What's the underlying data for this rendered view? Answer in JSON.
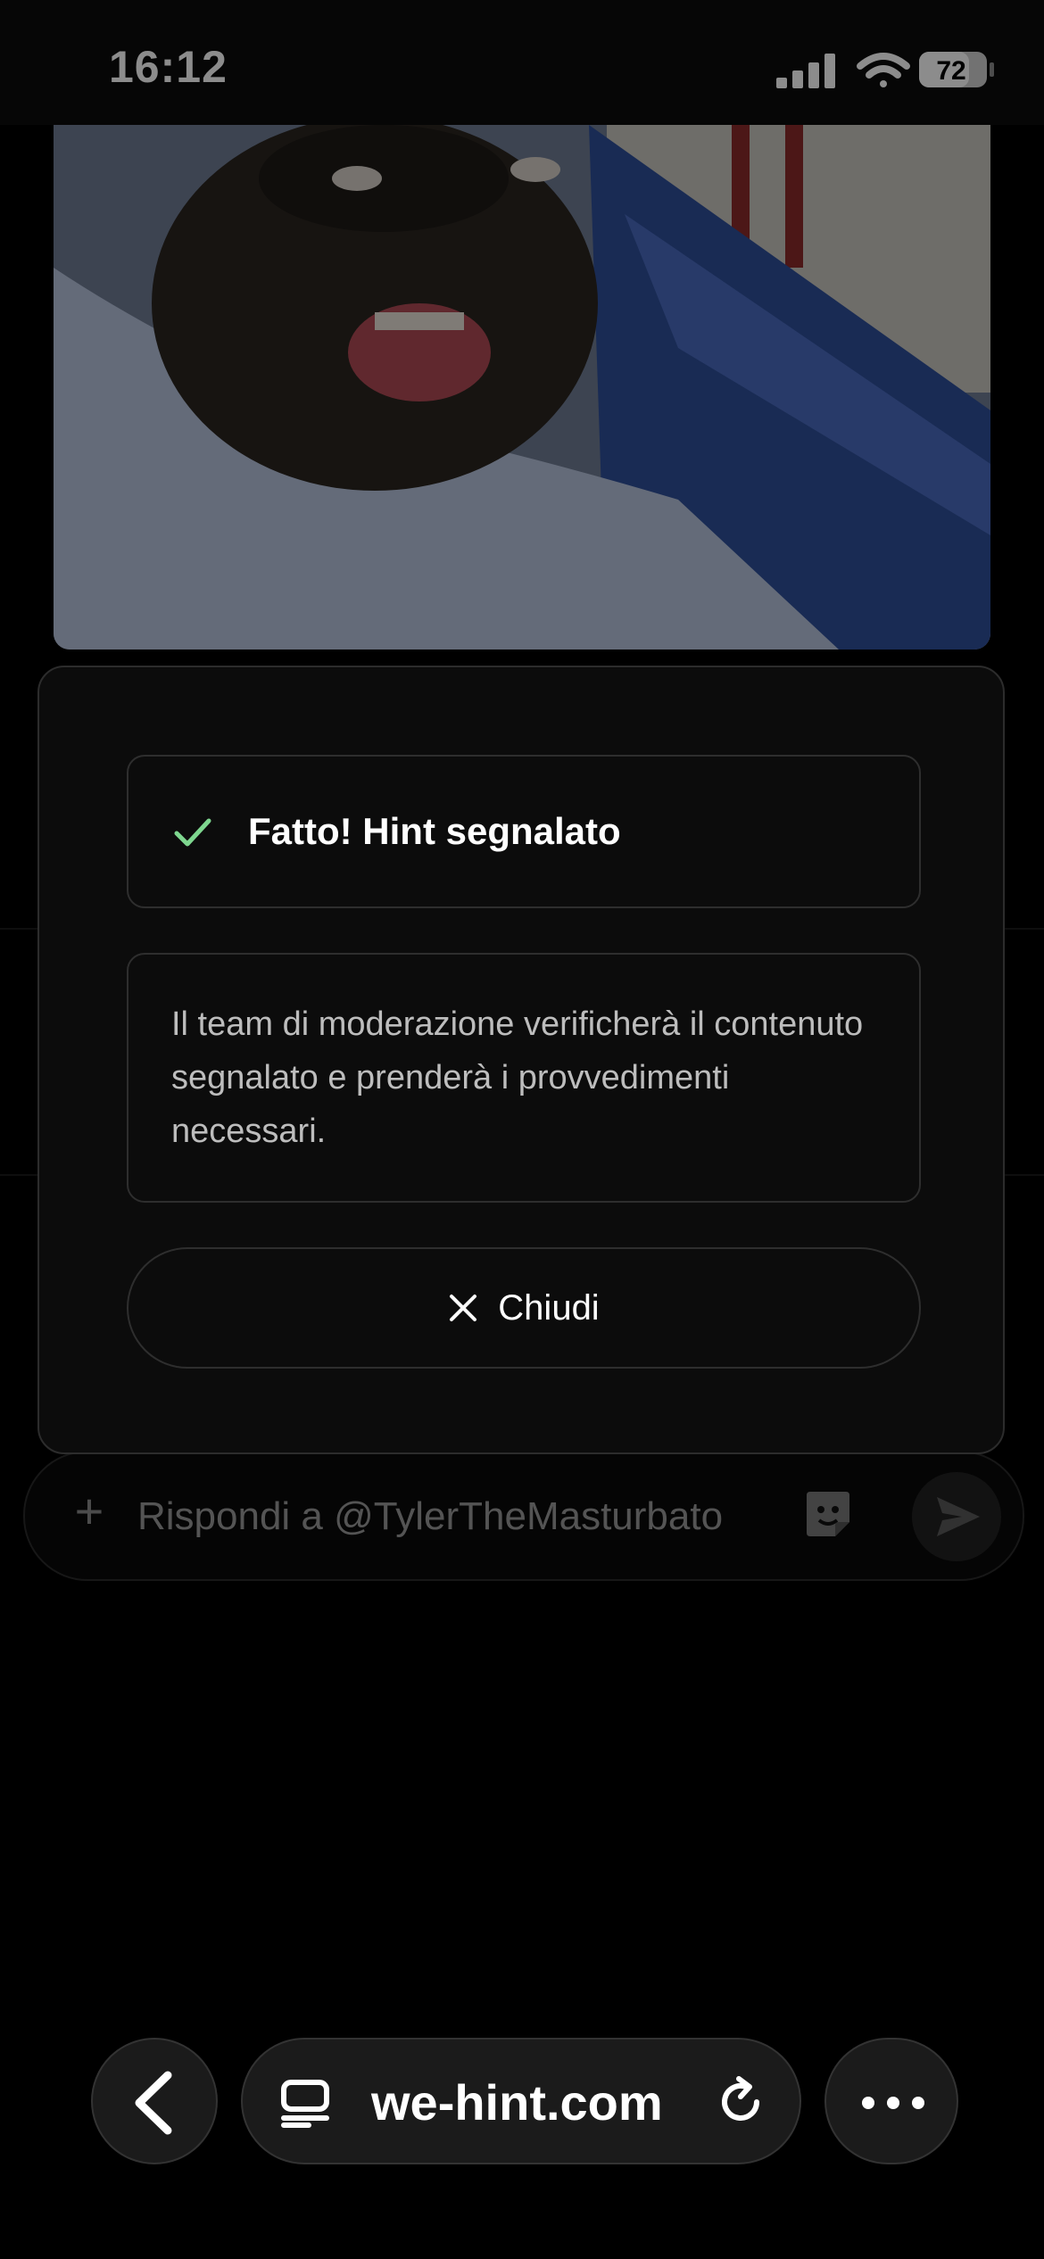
{
  "status_bar": {
    "time": "16:12",
    "battery": "72"
  },
  "composer": {
    "placeholder": "Rispondi a @TylerTheMasturbato"
  },
  "alert": {
    "title": "Fatto! Hint segnalato",
    "description": "Il team di moderazione verificherà il contenuto segnalato e prenderà i provvedimenti necessari.",
    "close_label": "Chiudi",
    "accent_color": "#7ed68f"
  },
  "browser": {
    "address": "we-hint.com"
  },
  "icons": [
    "signal-icon",
    "wifi-icon",
    "battery-icon",
    "check-icon",
    "close-icon",
    "plus-icon",
    "sticker-icon",
    "send-icon",
    "back-icon",
    "tabs-icon",
    "reload-icon",
    "more-icon"
  ]
}
